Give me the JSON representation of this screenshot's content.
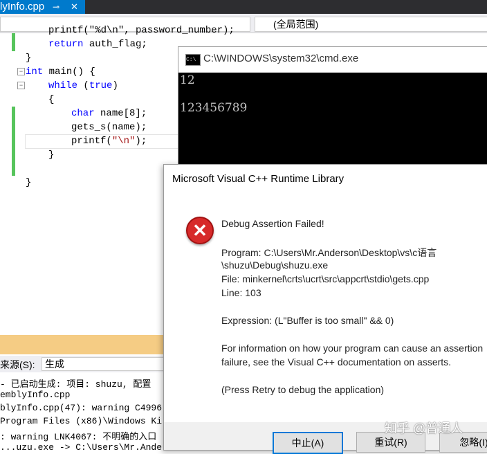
{
  "tab": {
    "name": "lyInfo.cpp",
    "pin_glyph": "⊸",
    "close_glyph": "✕"
  },
  "navbar": {
    "scope": "(全局范围)"
  },
  "code": {
    "partial_top": "printf(\"%d\\n\", password_number);",
    "return_line": "return auth_flag;",
    "close1": "}",
    "main_kw": "int",
    "main_rest": " main() {",
    "while_kw": "while",
    "while_open": " (",
    "while_true": "true",
    "while_close": ")",
    "brace_open": "{",
    "char_kw": "char",
    "char_rest": " name[8];",
    "gets": "gets_s(name);",
    "printf_a": "printf(",
    "printf_str": "\"\\n\"",
    "printf_b": ");",
    "brace_close_inner": "}",
    "brace_close_outer": "}"
  },
  "cmd": {
    "title": "C:\\WINDOWS\\system32\\cmd.exe",
    "icon_text": "C:\\",
    "lines": [
      "12",
      "123456789"
    ]
  },
  "output": {
    "source_label": "来源(S):",
    "source_value": "生成",
    "lines": [
      "- 已启动生成: 项目: shuzu, 配置",
      "emblyInfo.cpp",
      "blyInfo.cpp(47): warning C4996",
      "Program Files (x86)\\Windows Ki",
      ": warning LNK4067: 不明确的入口",
      "...uzu.exe -> C:\\Users\\Mr.Ande"
    ]
  },
  "dialog": {
    "title": "Microsoft Visual C++ Runtime Library",
    "icon": "error-icon",
    "heading": "Debug Assertion Failed!",
    "program_line1": "Program: C:\\Users\\Mr.Anderson\\Desktop\\vs\\c语言",
    "program_line2": "\\shuzu\\Debug\\shuzu.exe",
    "file_line": "File: minkernel\\crts\\ucrt\\src\\appcrt\\stdio\\gets.cpp",
    "line_line": "Line: 103",
    "expression": "Expression: (L\"Buffer is too small\" && 0)",
    "info1": "For information on how your program can cause an assertion",
    "info2": "failure, see the Visual C++ documentation on asserts.",
    "press": "(Press Retry to debug the application)",
    "buttons": {
      "abort": "中止(A)",
      "retry": "重试(R)",
      "ignore": "忽略(I)"
    }
  },
  "watermark": "知乎 @普通人"
}
